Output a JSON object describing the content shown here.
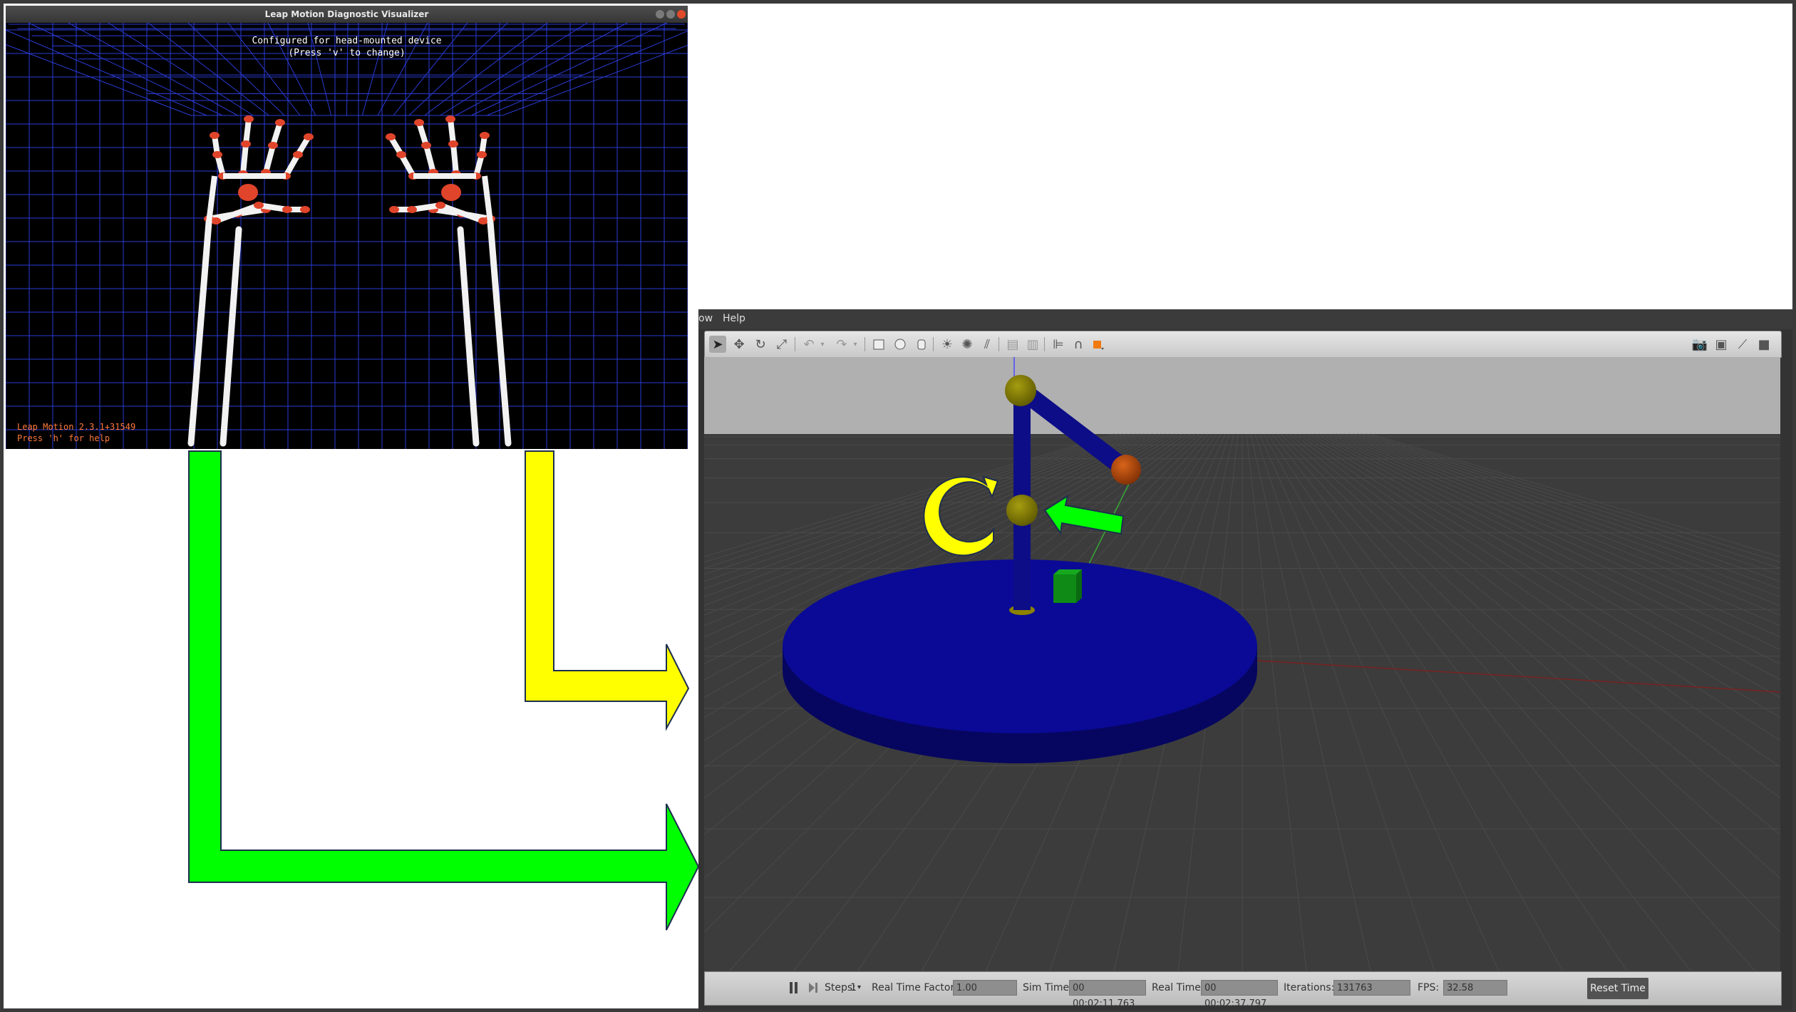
{
  "leap": {
    "title": "Leap Motion Diagnostic Visualizer",
    "config_line1": "Configured for head-mounted device",
    "config_line2": "(Press 'v' to change)",
    "version": "Leap Motion 2.3.1+31549",
    "help": "Press 'h' for help"
  },
  "gazebo": {
    "menu_partial": "ow",
    "menu_help": "Help",
    "status": {
      "steps_label": "Steps:",
      "steps_value": "1",
      "rtf_label": "Real Time Factor:",
      "rtf_value": "1.00",
      "sim_time_label": "Sim Time:",
      "sim_time_value": "00 00:02:11.763",
      "real_time_label": "Real Time:",
      "real_time_value": "00 00:02:37.797",
      "iterations_label": "Iterations:",
      "iterations_value": "131763",
      "fps_label": "FPS:",
      "fps_value": "32.58",
      "reset_label": "Reset Time"
    }
  },
  "colors": {
    "grid": "#2a3bd6",
    "bone": "#f2f2f2",
    "joint": "#e0442a",
    "arm_blue": "#0c0c90",
    "joint_olive": "#807a00",
    "end_effector": "#b84a10",
    "cube_green": "#0f8a16",
    "arrow_green": "#00ff00",
    "arrow_yellow": "#ffff00"
  }
}
